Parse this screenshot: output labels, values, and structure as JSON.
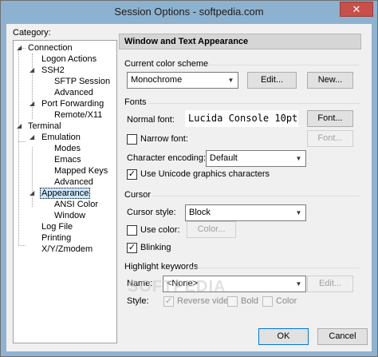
{
  "window": {
    "title": "Session Options - softpedia.com",
    "close_glyph": "✕"
  },
  "category": {
    "label": "Category:",
    "items": [
      "Connection",
      "Logon Actions",
      "SSH2",
      "SFTP Session",
      "Advanced",
      "Port Forwarding",
      "Remote/X11",
      "Terminal",
      "Emulation",
      "Modes",
      "Emacs",
      "Mapped Keys",
      "Advanced",
      "Appearance",
      "ANSI Color",
      "Window",
      "Log File",
      "Printing",
      "X/Y/Zmodem"
    ],
    "selected": "Appearance"
  },
  "panel": {
    "header": "Window and Text Appearance",
    "color_scheme": {
      "title": "Current color scheme",
      "value": "Monochrome",
      "edit_label": "Edit...",
      "new_label": "New..."
    },
    "fonts": {
      "title": "Fonts",
      "normal_font_label": "Normal font:",
      "normal_font_value": "Lucida Console 10pt",
      "font_button": "Font...",
      "narrow_font_label": "Narrow font:",
      "narrow_font_checked": false,
      "narrow_font_button": "Font...",
      "encoding_label": "Character encoding:",
      "encoding_value": "Default",
      "unicode_label": "Use Unicode graphics characters",
      "unicode_checked": true
    },
    "cursor": {
      "title": "Cursor",
      "style_label": "Cursor style:",
      "style_value": "Block",
      "use_color_label": "Use color:",
      "use_color_checked": false,
      "color_button": "Color...",
      "blinking_label": "Blinking",
      "blinking_checked": true
    },
    "highlight": {
      "title": "Highlight keywords",
      "name_label": "Name:",
      "name_value": "<None>",
      "edit_label": "Edit...",
      "style_label": "Style:",
      "reverse_video_label": "Reverse video",
      "reverse_video_checked": true,
      "bold_label": "Bold",
      "color_label": "Color"
    },
    "watermark": "SOFTPEDIA"
  },
  "footer": {
    "ok_label": "OK",
    "cancel_label": "Cancel"
  },
  "colors": {
    "titlebar": "#8db2d0",
    "selection": "#cce8ff",
    "close": "#c7504b"
  }
}
